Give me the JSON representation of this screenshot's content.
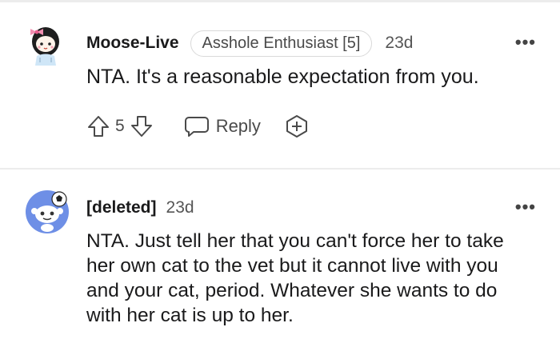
{
  "comments": [
    {
      "username": "Moose-Live",
      "flair": "Asshole Enthusiast [5]",
      "time": "23d",
      "more": "•••",
      "body": "NTA. It's a reasonable expectation from you.",
      "score": "5",
      "reply_label": "Reply",
      "avatar_icon": "snoo-girl-avatar-icon"
    },
    {
      "username": "[deleted]",
      "time": "23d",
      "more": "•••",
      "body": "NTA. Just tell her that you can't force her to take her own cat to the vet but it cannot live with you and your cat, period. Whatever she wants to do with her cat is up to her.",
      "avatar_icon": "default-snoo-avatar-icon"
    }
  ],
  "colors": {
    "divider": "#ececec",
    "text": "#1a1a1b",
    "muted": "#555555",
    "default_avatar_bg": "#6e8fe6"
  }
}
